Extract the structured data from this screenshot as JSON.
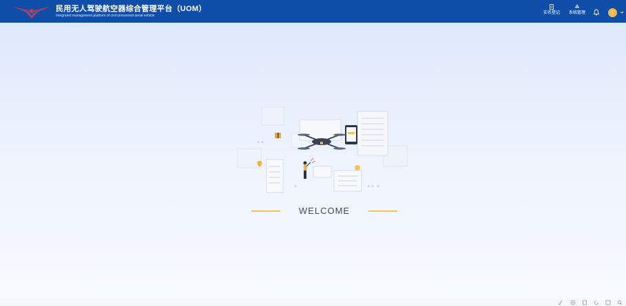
{
  "header": {
    "title": "民用无人驾驶航空器综合管理平台（UOM）",
    "subtitle": "Integrated management platform of civil unmanned aerial vehicle",
    "nav": [
      {
        "label": "实名登记",
        "icon": "document-icon"
      },
      {
        "label": "系统管理",
        "icon": "recycle-icon"
      }
    ],
    "bell_icon": "bell-icon",
    "avatar_text": "!"
  },
  "main": {
    "welcome_text": "WELCOME"
  },
  "footer": {
    "icons": [
      "broom-icon",
      "target-icon",
      "clipboard-icon",
      "reload-icon",
      "expand-icon",
      "search-icon"
    ]
  },
  "colors": {
    "header_bg": "#0f4ea8",
    "accent": "#f2c453",
    "background": "#e8f0fc"
  }
}
